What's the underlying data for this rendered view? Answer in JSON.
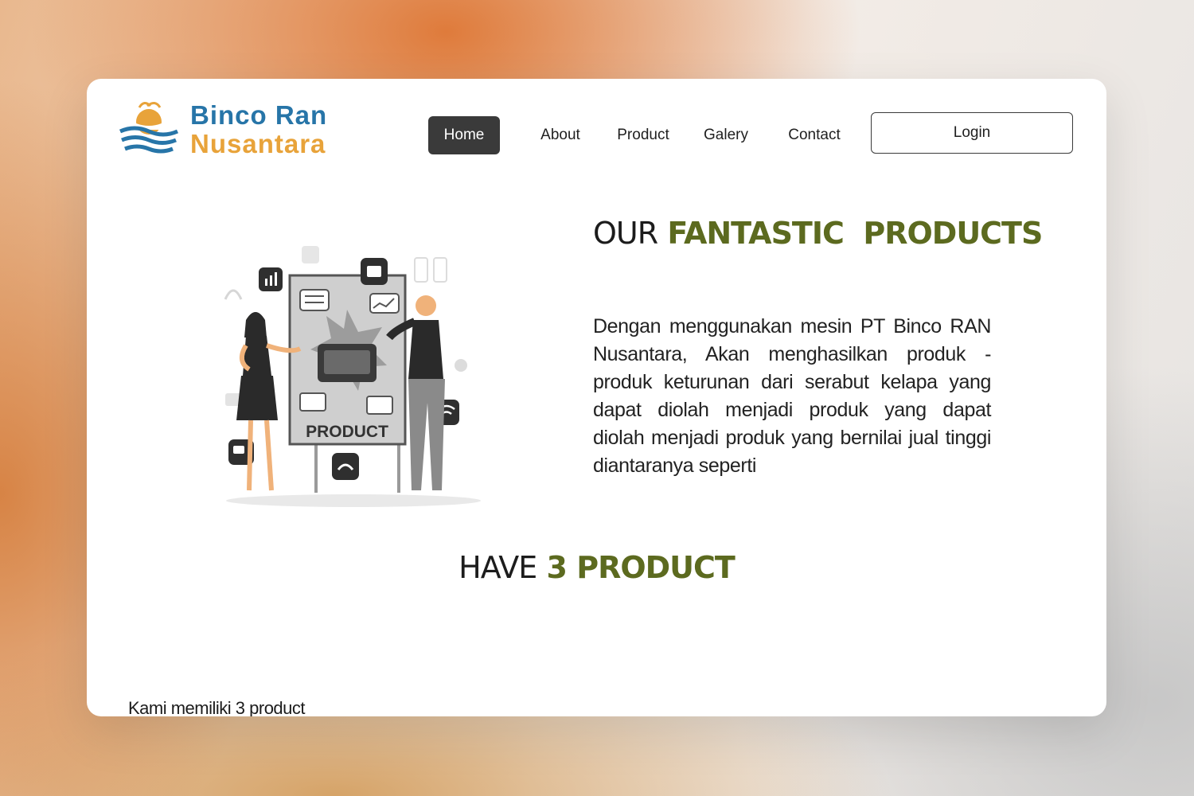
{
  "brand": {
    "line1": "Binco Ran",
    "line2": "Nusantara",
    "logo_icon": "coconut-wave-logo-icon",
    "colors": {
      "blue": "#2775a8",
      "orange": "#e8a33a"
    }
  },
  "nav": {
    "items": [
      {
        "label": "Home",
        "active": true
      },
      {
        "label": "About"
      },
      {
        "label": "Product"
      },
      {
        "label": "Galery"
      },
      {
        "label": "Contact"
      }
    ],
    "login_label": "Login"
  },
  "hero": {
    "title_part1": "OUR",
    "title_part2": "FANTASTIC",
    "title_part3": "PRODUCTS",
    "description": "Dengan menggunakan  mesin PT Binco RAN Nusantara, Akan menghasilkan produk - produk keturunan dari serabut kelapa yang dapat diolah menjadi produk yang dapat diolah menjadi produk yang bernilai jual tinggi diantaranya seperti",
    "illustration_label": "PRODUCT",
    "accent_color": "#5c6a1f"
  },
  "section": {
    "title_part1": "HAVE",
    "title_part2": "3 PRODUCT",
    "subtitle": "Kami memiliki 3 product"
  }
}
